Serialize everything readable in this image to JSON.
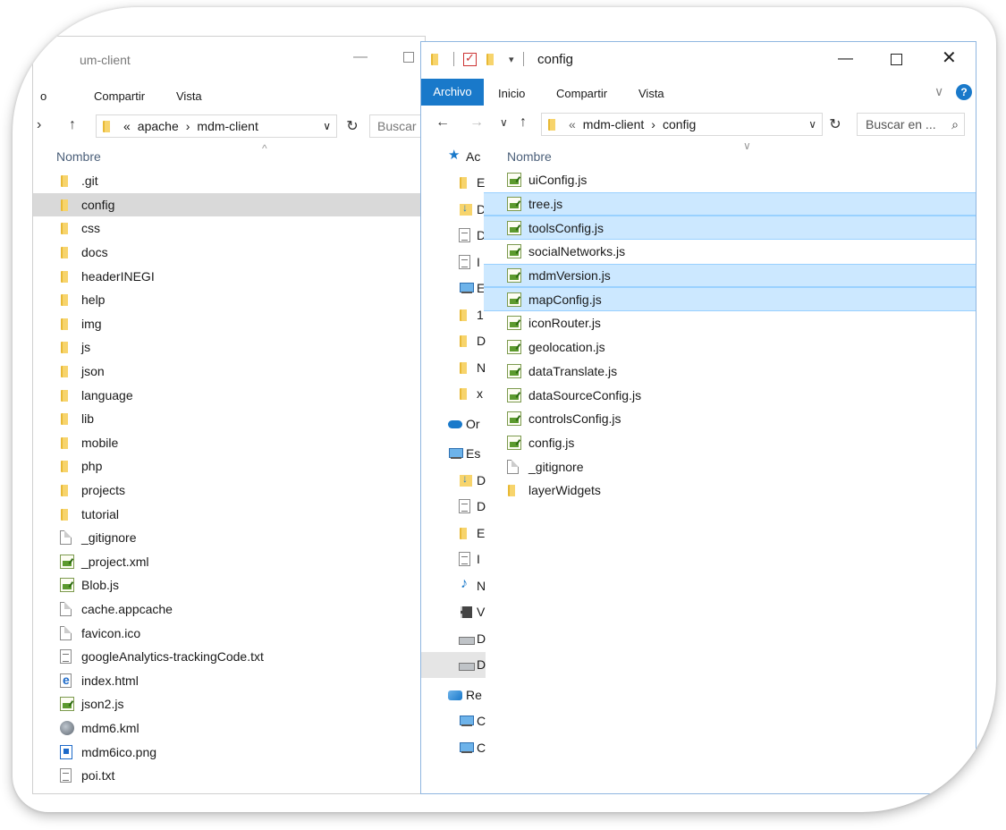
{
  "back_window": {
    "title_partial": "um-client",
    "ribbon": {
      "tab_partial": "o",
      "compartir": "Compartir",
      "vista": "Vista"
    },
    "address": {
      "prefix": "«",
      "segments": [
        "apache",
        "mdm-client"
      ]
    },
    "search_partial": "Buscar e",
    "column_name": "Nombre",
    "items": [
      {
        "name": ".git",
        "type": "folder"
      },
      {
        "name": "config",
        "type": "folder",
        "selected": true
      },
      {
        "name": "css",
        "type": "folder"
      },
      {
        "name": "docs",
        "type": "folder"
      },
      {
        "name": "headerINEGI",
        "type": "folder"
      },
      {
        "name": "help",
        "type": "folder"
      },
      {
        "name": "img",
        "type": "folder"
      },
      {
        "name": "js",
        "type": "folder"
      },
      {
        "name": "json",
        "type": "folder"
      },
      {
        "name": "language",
        "type": "folder"
      },
      {
        "name": "lib",
        "type": "folder"
      },
      {
        "name": "mobile",
        "type": "folder"
      },
      {
        "name": "php",
        "type": "folder"
      },
      {
        "name": "projects",
        "type": "folder"
      },
      {
        "name": "tutorial",
        "type": "folder"
      },
      {
        "name": "_gitignore",
        "type": "doc"
      },
      {
        "name": "_project.xml",
        "type": "js"
      },
      {
        "name": "Blob.js",
        "type": "js"
      },
      {
        "name": "cache.appcache",
        "type": "doc"
      },
      {
        "name": "favicon.ico",
        "type": "doc"
      },
      {
        "name": "googleAnalytics-trackingCode.txt",
        "type": "txt"
      },
      {
        "name": "index.html",
        "type": "html"
      },
      {
        "name": "json2.js",
        "type": "js"
      },
      {
        "name": "mdm6.kml",
        "type": "kml"
      },
      {
        "name": "mdm6ico.png",
        "type": "png"
      },
      {
        "name": "poi.txt",
        "type": "txt"
      }
    ]
  },
  "front_window": {
    "title": "config",
    "ribbon": {
      "archivo": "Archivo",
      "inicio": "Inicio",
      "compartir": "Compartir",
      "vista": "Vista",
      "help": "?"
    },
    "address": {
      "prefix": "«",
      "segments": [
        "mdm-client",
        "config"
      ]
    },
    "search_placeholder": "Buscar en ...",
    "column_name": "Nombre",
    "nav_items": [
      {
        "icon": "star",
        "label": "Ac"
      },
      {
        "icon": "folder",
        "label": "E"
      },
      {
        "icon": "dl",
        "label": "D"
      },
      {
        "icon": "txt",
        "label": "D"
      },
      {
        "icon": "txt",
        "label": "I"
      },
      {
        "icon": "pc",
        "label": "E"
      },
      {
        "icon": "folder",
        "label": "1"
      },
      {
        "icon": "folder",
        "label": "D"
      },
      {
        "icon": "folder",
        "label": "N"
      },
      {
        "icon": "folder",
        "label": "x"
      },
      {
        "icon": "cloud",
        "label": "Or"
      },
      {
        "icon": "pc",
        "label": "Es"
      },
      {
        "icon": "dl",
        "label": "D"
      },
      {
        "icon": "txt",
        "label": "D"
      },
      {
        "icon": "folder",
        "label": "E"
      },
      {
        "icon": "txt",
        "label": "I"
      },
      {
        "icon": "music",
        "label": "N"
      },
      {
        "icon": "video",
        "label": "V"
      },
      {
        "icon": "drive",
        "label": "D"
      },
      {
        "icon": "drive",
        "label": "D",
        "selected": true
      },
      {
        "icon": "net",
        "label": "Re"
      },
      {
        "icon": "pc",
        "label": "C"
      },
      {
        "icon": "pc",
        "label": "C"
      }
    ],
    "items": [
      {
        "name": "uiConfig.js",
        "type": "js"
      },
      {
        "name": "tree.js",
        "type": "js",
        "selected": true
      },
      {
        "name": "toolsConfig.js",
        "type": "js",
        "selected": true
      },
      {
        "name": "socialNetworks.js",
        "type": "js"
      },
      {
        "name": "mdmVersion.js",
        "type": "js",
        "selected": true
      },
      {
        "name": "mapConfig.js",
        "type": "js",
        "selected": true
      },
      {
        "name": "iconRouter.js",
        "type": "js"
      },
      {
        "name": "geolocation.js",
        "type": "js"
      },
      {
        "name": "dataTranslate.js",
        "type": "js"
      },
      {
        "name": "dataSourceConfig.js",
        "type": "js"
      },
      {
        "name": "controlsConfig.js",
        "type": "js"
      },
      {
        "name": "config.js",
        "type": "js"
      },
      {
        "name": "_gitignore",
        "type": "doc"
      },
      {
        "name": "layerWidgets",
        "type": "folder"
      }
    ]
  }
}
